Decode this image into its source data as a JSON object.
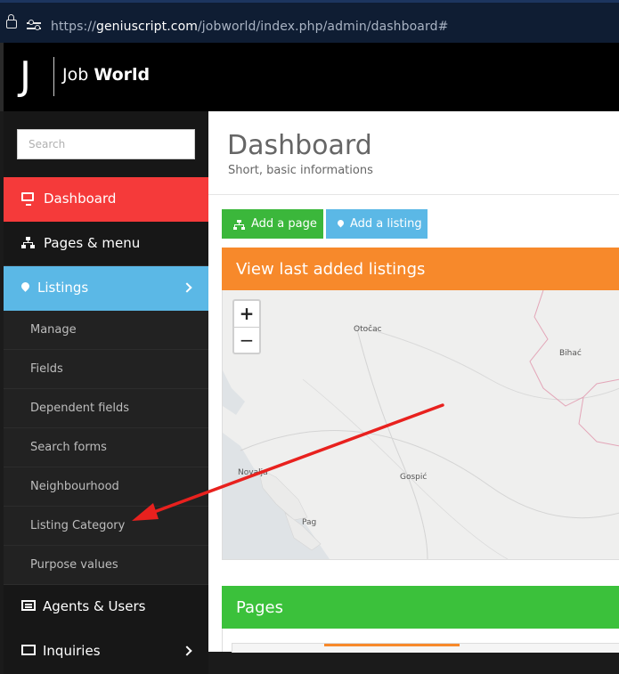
{
  "browser": {
    "url_scheme": "https://",
    "url_host": "geniuscript.com",
    "url_path": "/jobworld/index.php/admin/dashboard#"
  },
  "brand": {
    "letter": "J",
    "name_light": "Job",
    "name_bold": "World"
  },
  "sidebar": {
    "search_placeholder": "Search",
    "items": [
      {
        "label": "Dashboard",
        "icon": "desktop-icon"
      },
      {
        "label": "Pages & menu",
        "icon": "sitemap-icon"
      },
      {
        "label": "Listings",
        "icon": "map-pin-icon"
      },
      {
        "label": "Agents & Users",
        "icon": "id-card-icon"
      },
      {
        "label": "Inquiries",
        "icon": "envelope-icon"
      }
    ],
    "listings_submenu": [
      "Manage",
      "Fields",
      "Dependent fields",
      "Search forms",
      "Neighbourhood",
      "Listing Category",
      "Purpose values"
    ]
  },
  "main": {
    "title": "Dashboard",
    "subtitle": "Short, basic informations",
    "buttons": {
      "add_page": "Add a page",
      "add_listing": "Add a listing"
    },
    "listings_panel_title": "View last added listings",
    "pages_panel_title": "Pages",
    "map": {
      "zoom_in": "+",
      "zoom_out": "−",
      "places": [
        "Otočac",
        "Bihać",
        "Gospić",
        "Novalja",
        "Pag"
      ]
    }
  },
  "colors": {
    "dashboard_active": "#f53a3a",
    "listings_active": "#5bb8e6",
    "add_page_button": "#3bb73b",
    "listings_panel": "#f7892b",
    "pages_panel": "#3bc13b",
    "annotation_arrow": "#e8211e"
  }
}
